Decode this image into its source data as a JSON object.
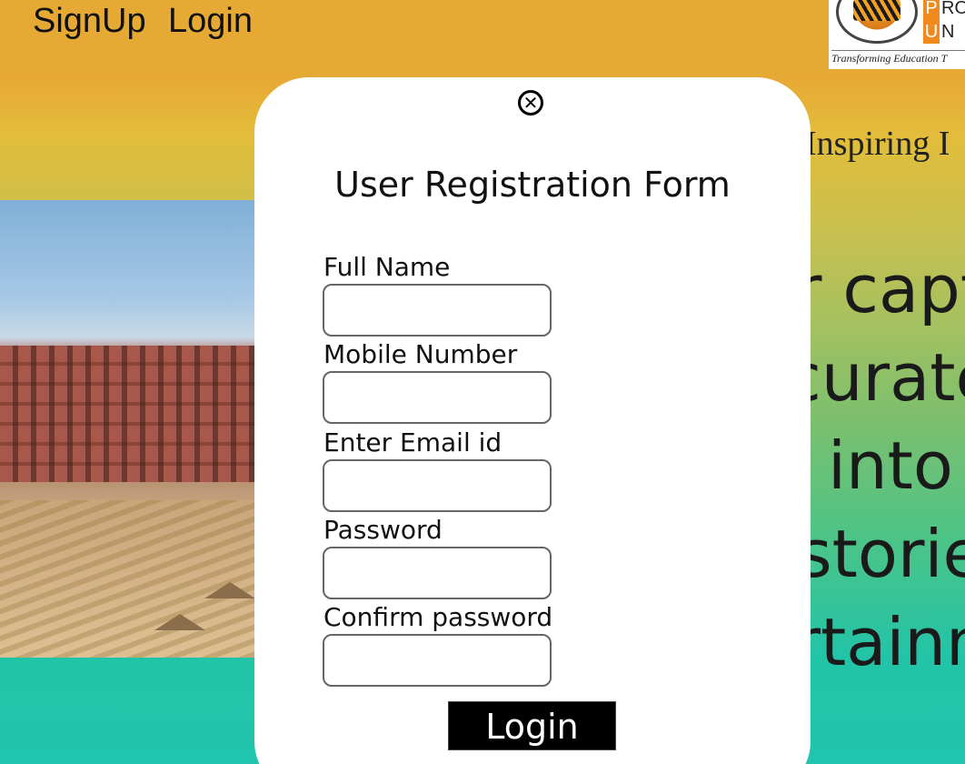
{
  "nav": {
    "signup_label": "SignUp",
    "login_label": "Login"
  },
  "logo": {
    "letters_line1": "RO",
    "letters_line2": "N",
    "badge_line1": "P",
    "badge_line2": "U",
    "tagline": "Transforming Education T"
  },
  "background": {
    "tagline": "Inspiring I",
    "hero_lines": [
      "r capt",
      "curate",
      "into",
      "storie",
      "rtainn"
    ]
  },
  "modal": {
    "close_icon": "close-circle-icon",
    "title": "User Registration Form",
    "fields": [
      {
        "label": "Full Name",
        "value": "",
        "placeholder": ""
      },
      {
        "label": "Mobile Number",
        "value": "",
        "placeholder": ""
      },
      {
        "label": "Enter Email id",
        "value": "",
        "placeholder": ""
      },
      {
        "label": "Password",
        "value": "",
        "placeholder": ""
      },
      {
        "label": "Confirm password",
        "value": "",
        "placeholder": ""
      }
    ],
    "submit_label": "Login"
  },
  "colors": {
    "topbar": "#e6a934",
    "gradient_bottom": "#21c4ac",
    "submit_bg": "#000000",
    "logo_accent": "#f08a1f"
  }
}
